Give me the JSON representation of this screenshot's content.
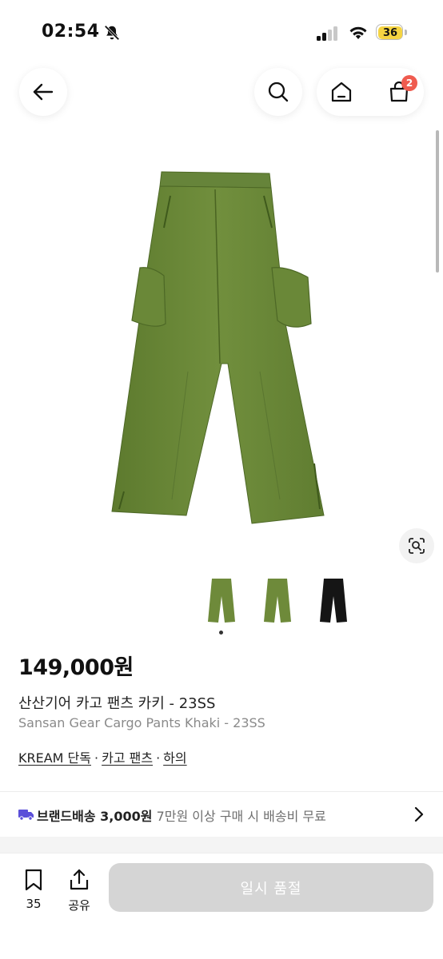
{
  "status_bar": {
    "time": "02:54",
    "battery": "36"
  },
  "nav": {
    "cart_count": "2"
  },
  "product": {
    "price": "149,000원",
    "title_ko": "산산기어 카고 팬츠 카키 - 23SS",
    "title_en": "Sansan Gear Cargo Pants Khaki - 23SS",
    "tags": [
      "KREAM 단독",
      "카고 팬츠",
      "하의"
    ],
    "tag_separator": "·",
    "thumbnails": [
      "khaki-front",
      "khaki-back",
      "black"
    ]
  },
  "shipping": {
    "label": "브랜드배송 3,000원",
    "desc": "7만원 이상 구매 시 배송비 무료"
  },
  "bottom_bar": {
    "bookmark_count": "35",
    "share_label": "공유",
    "soldout_label": "일시 품절"
  },
  "colors": {
    "accent_truck": "#5b4fd9",
    "badge": "#ef5b4f",
    "khaki": "#6e8a3a",
    "soldout_button": "#d5d5d5"
  }
}
